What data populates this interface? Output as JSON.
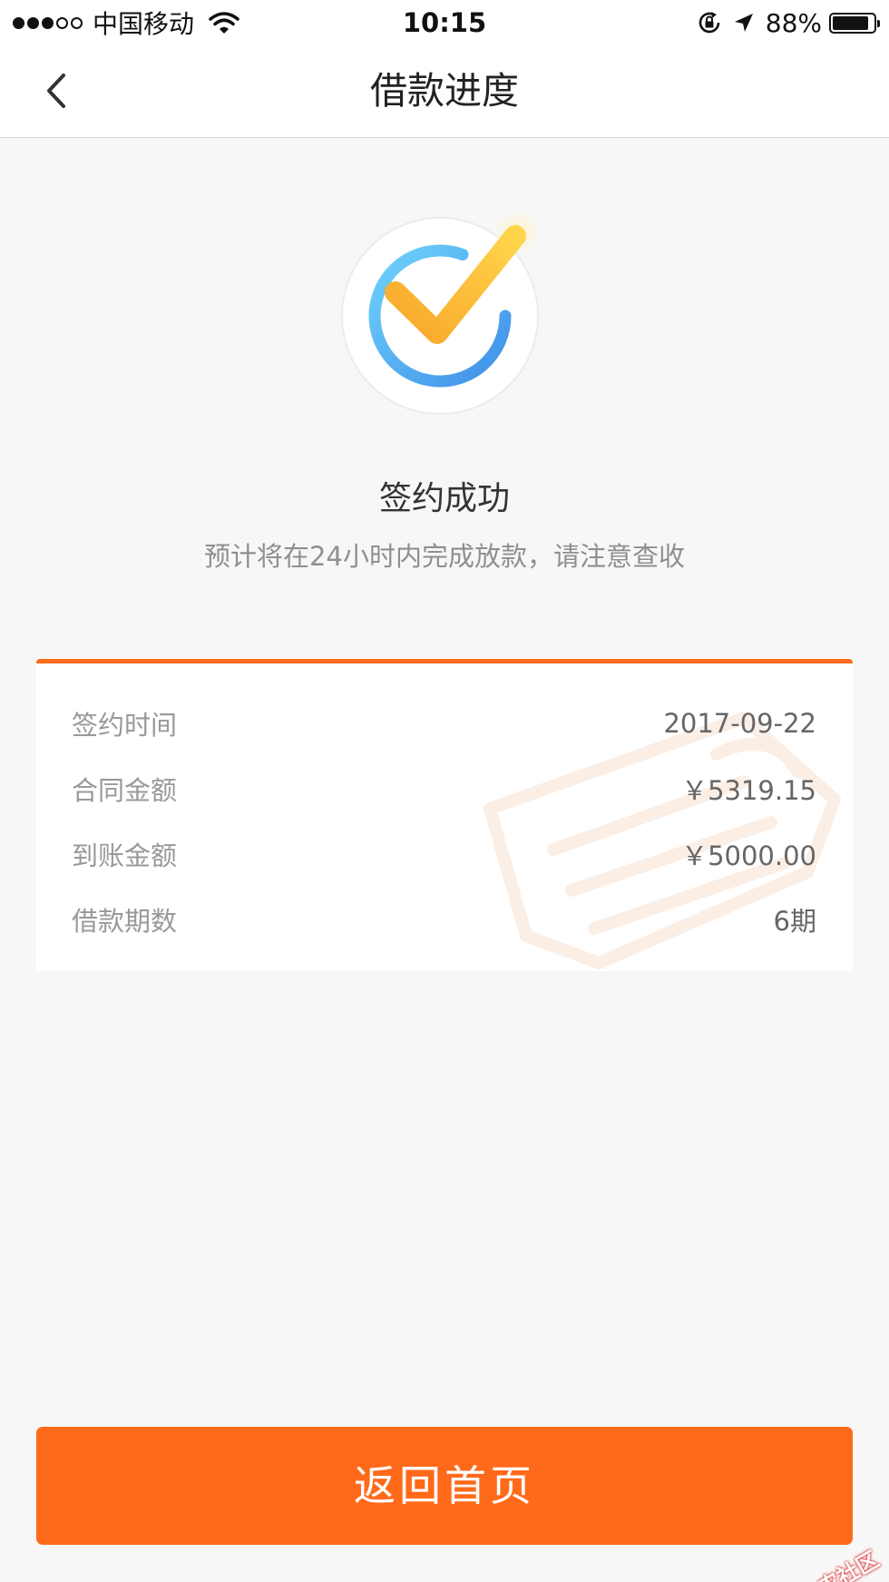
{
  "status_bar": {
    "carrier": "中国移动",
    "time": "10:15",
    "battery_percent": "88%",
    "battery_level": 0.88,
    "signal_bars_filled": 3,
    "signal_bars_total": 5
  },
  "nav": {
    "title": "借款进度",
    "back_icon": "chevron-left-icon"
  },
  "status": {
    "icon": "checkmark-circle-icon",
    "title": "签约成功",
    "description": "预计将在24小时内完成放款，请注意查收"
  },
  "details": {
    "rows": [
      {
        "label": "签约时间",
        "value": "2017-09-22"
      },
      {
        "label": "合同金额",
        "value": "￥5319.15"
      },
      {
        "label": "到账金额",
        "value": "￥5000.00"
      },
      {
        "label": "借款期数",
        "value": "6期"
      }
    ]
  },
  "actions": {
    "home_label": "返回首页"
  },
  "watermark": {
    "text": "卡农社区"
  },
  "colors": {
    "accent": "#ff6a1a",
    "check_yellow": "#f7b733",
    "ring_blue": "#4aa3f0",
    "background": "#f7f7f7"
  }
}
